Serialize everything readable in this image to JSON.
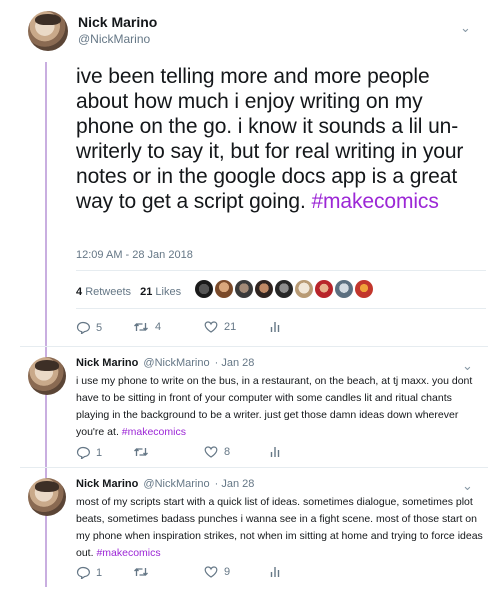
{
  "main_tweet": {
    "name": "Nick Marino",
    "handle": "@NickMarino",
    "text": "ive been telling more and more people about how much i enjoy writing on my phone on the go. i know it sounds a lil un-writerly to say it, but for real writing in your notes or in the google docs app is a great way to get a script going.",
    "hashtag": "#makecomics",
    "timestamp": "12:09 AM - 28 Jan 2018",
    "retweets_count": "4",
    "retweets_label": "Retweets",
    "likes_count": "21",
    "likes_label": "Likes",
    "reply_count": "5",
    "retweet_count": "4",
    "like_count": "21"
  },
  "replies": [
    {
      "name": "Nick Marino",
      "handle": "@NickMarino",
      "date": "· Jan 28",
      "text": "i use my phone to write on the bus, in a restaurant, on the beach, at tj maxx. you dont have to be sitting in front of your computer with some candles lit and ritual chants playing in the background to be a writer. just get those damn ideas down wherever you're at.",
      "hashtag": "#makecomics",
      "reply_count": "1",
      "like_count": "8"
    },
    {
      "name": "Nick Marino",
      "handle": "@NickMarino",
      "date": "· Jan 28",
      "text": "most of my scripts start with a quick list of ideas. sometimes dialogue, sometimes plot beats, sometimes badass punches i wanna see in a fight scene. most of those start on my phone when inspiration strikes, not when im sitting at home and trying to force ideas out.",
      "hashtag": "#makecomics",
      "reply_count": "1",
      "like_count": "9"
    }
  ],
  "colors": {
    "hashtag": "#9c27d6",
    "thread_line": "#c9aee0",
    "muted": "#657786"
  },
  "icons": {
    "reply": "reply-icon",
    "retweet": "retweet-icon",
    "like": "heart-icon",
    "analytics": "analytics-icon",
    "menu": "chevron-down-icon"
  }
}
